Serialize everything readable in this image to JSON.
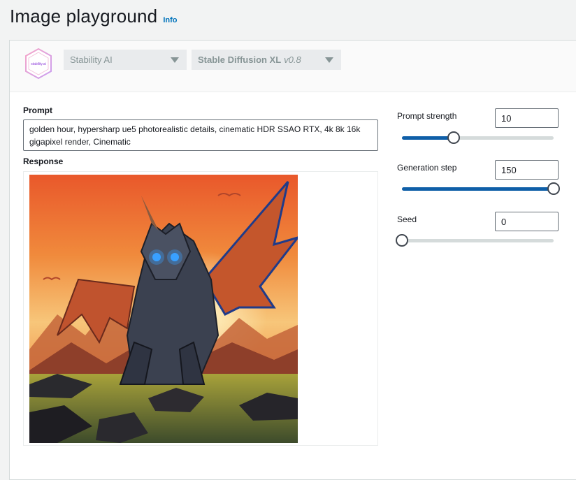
{
  "header": {
    "title": "Image playground",
    "info_label": "Info"
  },
  "model_selector": {
    "provider": "Stability AI",
    "model_name": "Stable Diffusion XL",
    "model_version": "v0.8",
    "logo_text": "stability.ai"
  },
  "prompt": {
    "label": "Prompt",
    "value": "golden hour, hypersharp ue5 photorealistic details, cinematic HDR SSAO RTX, 4k 8k 16k gigapixel render, Cinematic"
  },
  "response": {
    "label": "Response",
    "image_subject": "dragon-artwork"
  },
  "parameters": [
    {
      "key": "prompt_strength",
      "label": "Prompt strength",
      "value": "10",
      "slider_fraction": 0.34
    },
    {
      "key": "generation_step",
      "label": "Generation step",
      "value": "150",
      "slider_fraction": 1.0
    },
    {
      "key": "seed",
      "label": "Seed",
      "value": "0",
      "slider_fraction": 0.0
    }
  ],
  "colors": {
    "accent": "#0f5fa8",
    "link": "#0073bb",
    "panel_bg": "#ffffff",
    "page_bg": "#f2f3f3"
  }
}
